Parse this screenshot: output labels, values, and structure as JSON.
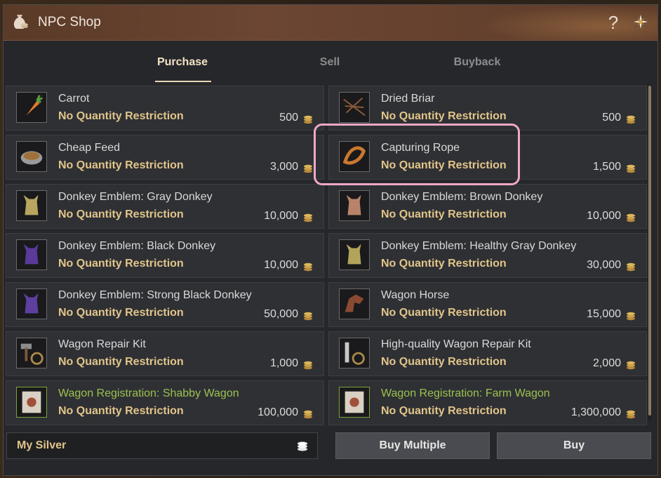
{
  "title": "NPC Shop",
  "help_label": "?",
  "tabs": [
    {
      "label": "Purchase",
      "active": true
    },
    {
      "label": "Sell",
      "active": false
    },
    {
      "label": "Buyback",
      "active": false
    }
  ],
  "items": [
    {
      "name": "Carrot",
      "restriction": "No Quantity Restriction",
      "price": "500",
      "icon": "carrot-icon"
    },
    {
      "name": "Dried Briar",
      "restriction": "No Quantity Restriction",
      "price": "500",
      "icon": "dried-briar-icon"
    },
    {
      "name": "Cheap Feed",
      "restriction": "No Quantity Restriction",
      "price": "3,000",
      "icon": "feed-bowl-icon"
    },
    {
      "name": "Capturing Rope",
      "restriction": "No Quantity Restriction",
      "price": "1,500",
      "icon": "rope-icon",
      "highlighted": true
    },
    {
      "name": "Donkey Emblem: Gray Donkey",
      "restriction": "No Quantity Restriction",
      "price": "10,000",
      "icon": "gray-donkey-emblem-icon"
    },
    {
      "name": "Donkey Emblem: Brown Donkey",
      "restriction": "No Quantity Restriction",
      "price": "10,000",
      "icon": "brown-donkey-emblem-icon"
    },
    {
      "name": "Donkey Emblem: Black Donkey",
      "restriction": "No Quantity Restriction",
      "price": "10,000",
      "icon": "black-donkey-emblem-icon"
    },
    {
      "name": "Donkey Emblem: Healthy Gray Donkey",
      "restriction": "No Quantity Restriction",
      "price": "30,000",
      "icon": "healthy-gray-donkey-emblem-icon"
    },
    {
      "name": "Donkey Emblem: Strong Black Donkey",
      "restriction": "No Quantity Restriction",
      "price": "50,000",
      "icon": "strong-black-donkey-emblem-icon"
    },
    {
      "name": "Wagon Horse",
      "restriction": "No Quantity Restriction",
      "price": "15,000",
      "icon": "horse-emblem-icon"
    },
    {
      "name": "Wagon Repair Kit",
      "restriction": "No Quantity Restriction",
      "price": "1,000",
      "icon": "repair-kit-icon"
    },
    {
      "name": "High-quality Wagon Repair Kit",
      "restriction": "No Quantity Restriction",
      "price": "2,000",
      "icon": "hq-repair-kit-icon"
    },
    {
      "name": "Wagon Registration: Shabby Wagon",
      "restriction": "No Quantity Restriction",
      "price": "100,000",
      "icon": "registration-scroll-icon",
      "rarity": "green"
    },
    {
      "name": "Wagon Registration: Farm Wagon",
      "restriction": "No Quantity Restriction",
      "price": "1,300,000",
      "icon": "registration-scroll-icon",
      "rarity": "green"
    }
  ],
  "footer": {
    "silver_label": "My Silver",
    "buy_multiple_label": "Buy Multiple",
    "buy_label": "Buy"
  },
  "colors": {
    "restriction": "#e1c58a",
    "green_item": "#9bc24f",
    "highlight": "#f0a8c8"
  }
}
